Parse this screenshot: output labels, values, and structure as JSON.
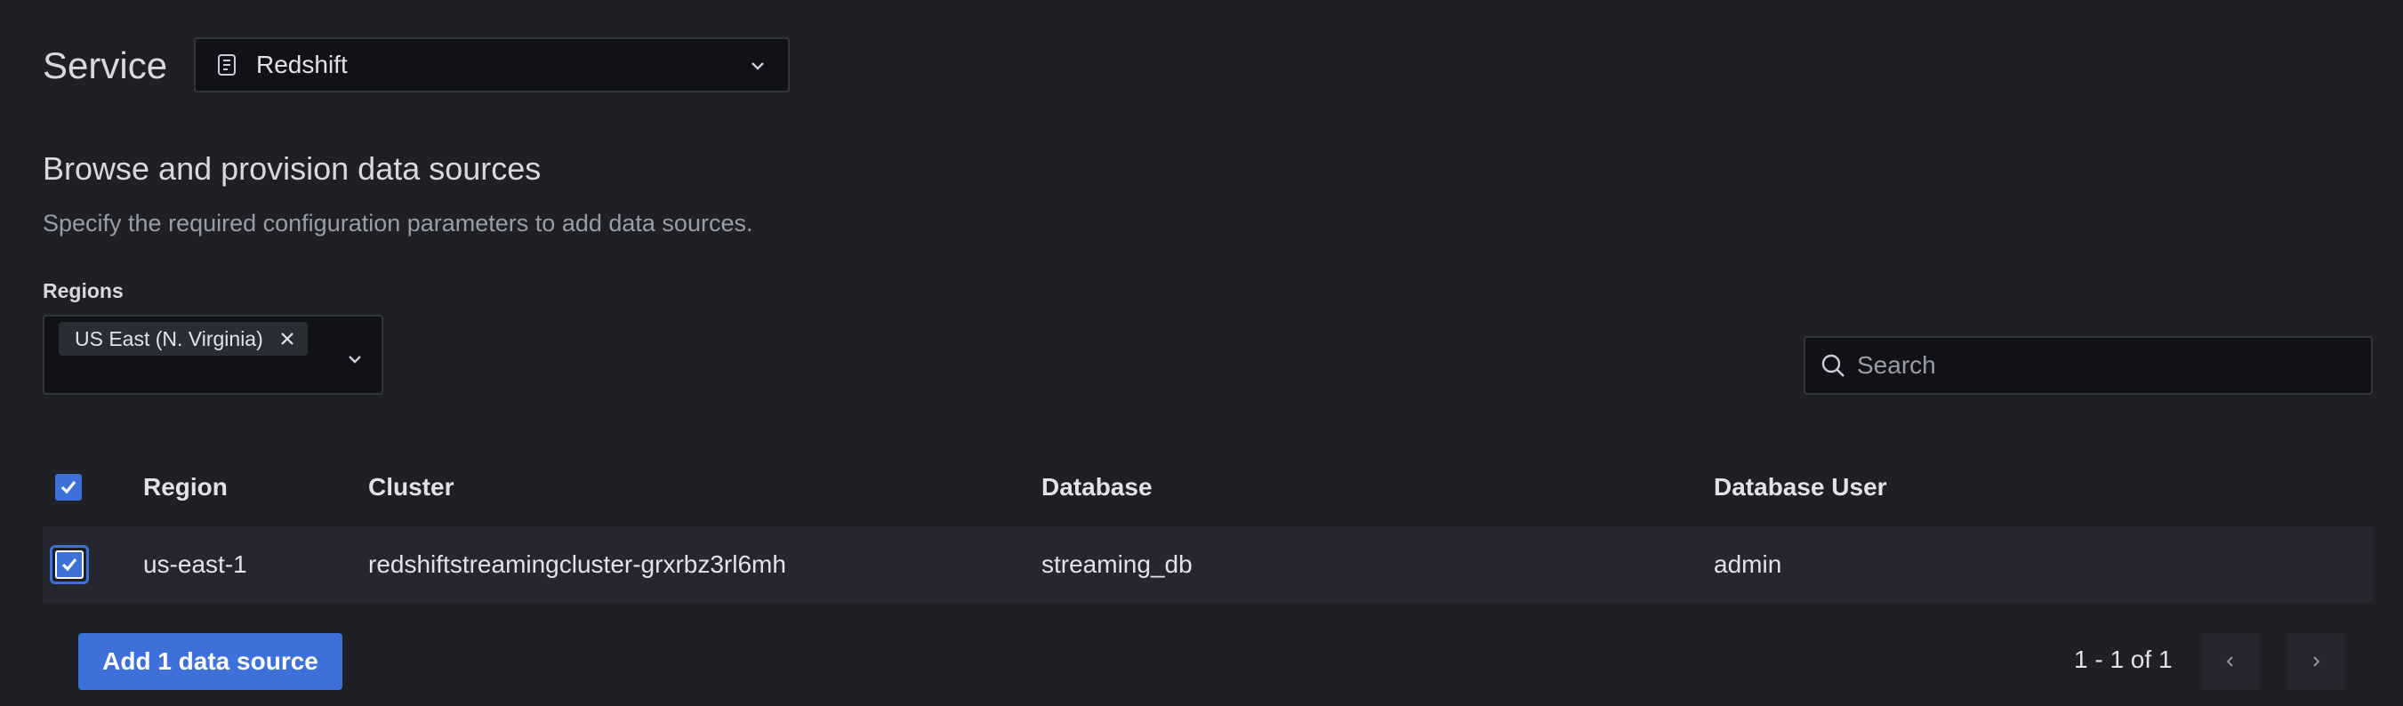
{
  "service": {
    "label": "Service",
    "selected": "Redshift",
    "icon": "redshift-icon"
  },
  "section": {
    "title": "Browse and provision data sources",
    "description": "Specify the required configuration parameters to add data sources."
  },
  "regions": {
    "label": "Regions",
    "selected": [
      "US East (N. Virginia)"
    ]
  },
  "search": {
    "placeholder": "Search",
    "value": ""
  },
  "table": {
    "columns": [
      "Region",
      "Cluster",
      "Database",
      "Database User"
    ],
    "header_checked": true,
    "rows": [
      {
        "checked": true,
        "region": "us-east-1",
        "cluster": "redshiftstreamingcluster-grxrbz3rl6mh",
        "database": "streaming_db",
        "user": "admin"
      }
    ]
  },
  "footer": {
    "add_button": "Add 1 data source",
    "pagination": "1 - 1 of 1"
  },
  "colors": {
    "background": "#1f2026",
    "accent": "#3d71d9",
    "input_bg": "#111217",
    "row_bg": "#26272e"
  }
}
